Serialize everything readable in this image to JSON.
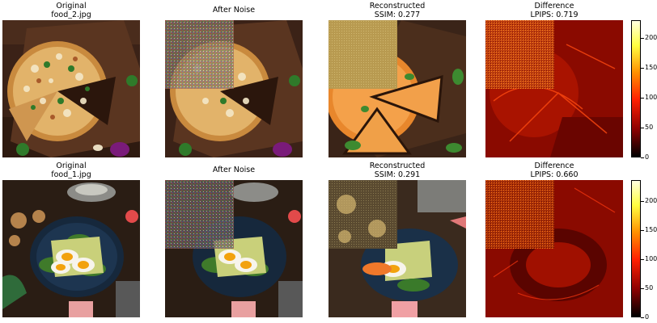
{
  "rows": [
    {
      "original": {
        "title_line1": "Original",
        "title_line2": "food_2.jpg"
      },
      "noise": {
        "title_line1": "After Noise"
      },
      "reconstructed": {
        "title_line1": "Reconstructed",
        "title_line2": "SSIM: 0.277"
      },
      "difference": {
        "title_line1": "Difference",
        "title_line2": "LPIPS: 0.719"
      }
    },
    {
      "original": {
        "title_line1": "Original",
        "title_line2": "food_1.jpg"
      },
      "noise": {
        "title_line1": "After Noise"
      },
      "reconstructed": {
        "title_line1": "Reconstructed",
        "title_line2": "SSIM: 0.291"
      },
      "difference": {
        "title_line1": "Difference",
        "title_line2": "LPIPS: 0.660"
      }
    }
  ],
  "colorbar": {
    "ticks": [
      "0",
      "50",
      "100",
      "150",
      "200"
    ],
    "colormap": "hot",
    "colors": [
      "#000000",
      "#8b0000",
      "#ff2000",
      "#ff9000",
      "#ffff40",
      "#ffffe0"
    ]
  },
  "chart_data": [
    {
      "type": "heatmap",
      "title": "Difference",
      "subtitle": "LPIPS: 0.719",
      "ylim": [
        0,
        230
      ],
      "colorbar_ticks": [
        0,
        50,
        100,
        150,
        200
      ],
      "ssim": 0.277,
      "lpips": 0.719
    },
    {
      "type": "heatmap",
      "title": "Difference",
      "subtitle": "LPIPS: 0.660",
      "ylim": [
        0,
        230
      ],
      "colorbar_ticks": [
        0,
        50,
        100,
        150,
        200
      ],
      "ssim": 0.291,
      "lpips": 0.66
    }
  ]
}
